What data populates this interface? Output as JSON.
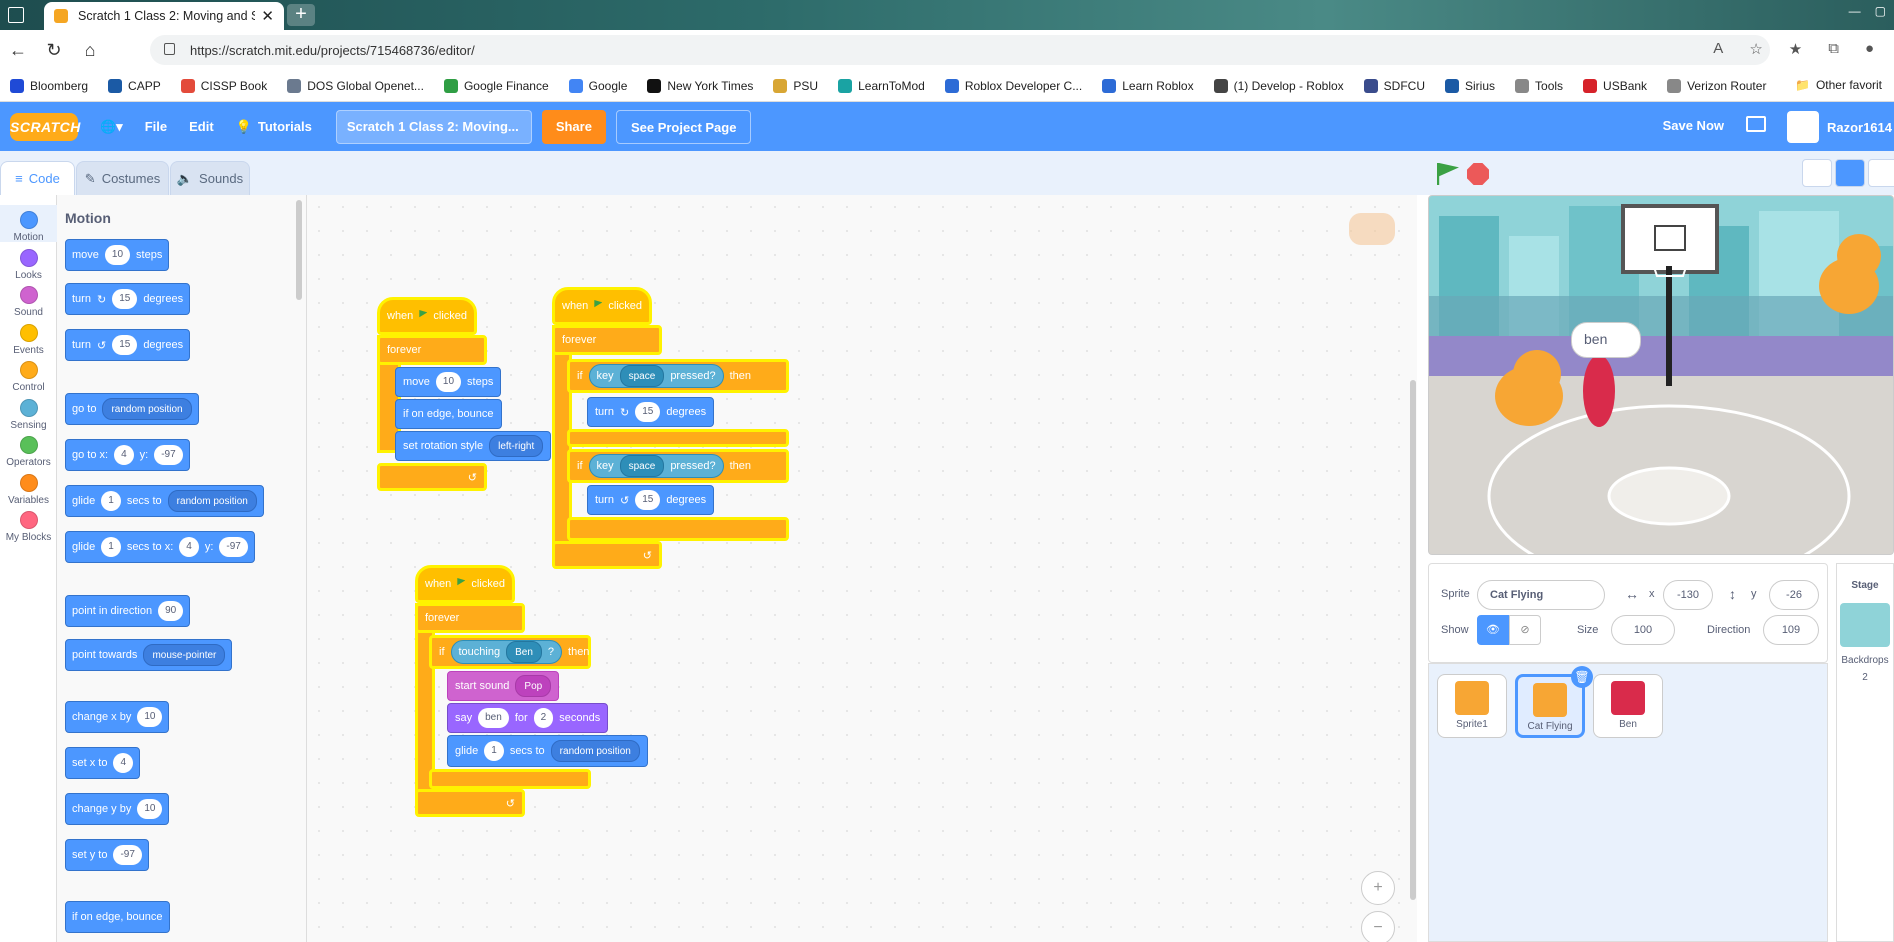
{
  "browser": {
    "tab_title": "Scratch 1 Class 2: Moving and Sc",
    "url": "https://scratch.mit.edu/projects/715468736/editor/",
    "bookmarks": [
      {
        "label": "Bloomberg",
        "color": "#1f4ad6"
      },
      {
        "label": "CAPP",
        "color": "#1b5aa5"
      },
      {
        "label": "CISSP Book",
        "color": "#e34b3b"
      },
      {
        "label": "DOS Global Openet...",
        "color": "#6b7a8f"
      },
      {
        "label": "Google Finance",
        "color": "#2f9e44"
      },
      {
        "label": "Google",
        "color": "#4285f4"
      },
      {
        "label": "New York Times",
        "color": "#111111"
      },
      {
        "label": "PSU",
        "color": "#d8a634"
      },
      {
        "label": "LearnToMod",
        "color": "#1aa3a3"
      },
      {
        "label": "Roblox Developer C...",
        "color": "#2d6bd6"
      },
      {
        "label": "Learn Roblox",
        "color": "#2d6bd6"
      },
      {
        "label": "(1) Develop - Roblox",
        "color": "#444444"
      },
      {
        "label": "SDFCU",
        "color": "#3a4c8c"
      },
      {
        "label": "Sirius",
        "color": "#1b5aa5"
      },
      {
        "label": "Tools",
        "color": "#888888"
      },
      {
        "label": "USBank",
        "color": "#d6222a"
      },
      {
        "label": "Verizon Router",
        "color": "#888888"
      }
    ],
    "other_favorites": "Other favorit"
  },
  "menu": {
    "logo": "SCRATCH",
    "file": "File",
    "edit": "Edit",
    "tutorials": "Tutorials",
    "project_title": "Scratch 1 Class 2: Moving...",
    "share": "Share",
    "see_project_page": "See Project Page",
    "save_now": "Save Now",
    "username": "Razor1614"
  },
  "tabs": {
    "code": "Code",
    "costumes": "Costumes",
    "sounds": "Sounds"
  },
  "categories": [
    {
      "label": "Motion",
      "color": "#4c97ff"
    },
    {
      "label": "Looks",
      "color": "#9966ff"
    },
    {
      "label": "Sound",
      "color": "#cf63cf"
    },
    {
      "label": "Events",
      "color": "#ffbf00"
    },
    {
      "label": "Control",
      "color": "#ffab19"
    },
    {
      "label": "Sensing",
      "color": "#5cb1d6"
    },
    {
      "label": "Operators",
      "color": "#59c059"
    },
    {
      "label": "Variables",
      "color": "#ff8c1a"
    },
    {
      "label": "My Blocks",
      "color": "#ff6680"
    }
  ],
  "palette": {
    "heading": "Motion",
    "move": {
      "a": "move",
      "v": "10",
      "b": "steps"
    },
    "turn_cw": {
      "a": "turn",
      "v": "15",
      "b": "degrees"
    },
    "turn_ccw": {
      "a": "turn",
      "v": "15",
      "b": "degrees"
    },
    "goto": {
      "a": "go to",
      "d": "random position"
    },
    "gotoxy": {
      "a": "go to x:",
      "x": "4",
      "y_label": "y:",
      "y": "-97"
    },
    "glide_to": {
      "a": "glide",
      "v": "1",
      "b": "secs to",
      "d": "random position"
    },
    "glide_xy": {
      "a": "glide",
      "v": "1",
      "b": "secs to x:",
      "x": "4",
      "y_label": "y:",
      "y": "-97"
    },
    "point_dir": {
      "a": "point in direction",
      "v": "90"
    },
    "point_towards": {
      "a": "point towards",
      "d": "mouse-pointer"
    },
    "change_x": {
      "a": "change x by",
      "v": "10"
    },
    "set_x": {
      "a": "set x to",
      "v": "4"
    },
    "change_y": {
      "a": "change y by",
      "v": "10"
    },
    "set_y": {
      "a": "set y to",
      "v": "-97"
    },
    "bounce": {
      "a": "if on edge, bounce"
    }
  },
  "scripts": {
    "s1": {
      "when": "when",
      "clicked": "clicked",
      "forever": "forever",
      "move": "move",
      "move_v": "10",
      "steps": "steps",
      "bounce": "if on edge, bounce",
      "rot": "set rotation style",
      "rot_v": "left-right"
    },
    "s2": {
      "when": "when",
      "clicked": "clicked",
      "forever": "forever",
      "if1": "if",
      "key": "key",
      "space": "space",
      "pressed": "pressed?",
      "then": "then",
      "turn1": "turn",
      "turn1_v": "15",
      "deg": "degrees",
      "if2": "if",
      "turn2": "turn",
      "turn2_v": "15"
    },
    "s3": {
      "when": "when",
      "clicked": "clicked",
      "forever": "forever",
      "if": "if",
      "touching": "touching",
      "ben": "Ben",
      "q": "?",
      "then": "then",
      "start_sound": "start sound",
      "pop": "Pop",
      "say": "say",
      "say_v": "ben",
      "for": "for",
      "secs_v": "2",
      "seconds": "seconds",
      "glide": "glide",
      "glide_v": "1",
      "secs_to": "secs to",
      "random": "random position"
    }
  },
  "stage": {
    "bubble": "ben"
  },
  "sprite_info": {
    "sprite_label": "Sprite",
    "sprite_name": "Cat Flying",
    "x_label": "x",
    "x": "-130",
    "y_label": "y",
    "y": "-26",
    "show_label": "Show",
    "size_label": "Size",
    "size": "100",
    "direction_label": "Direction",
    "direction": "109"
  },
  "sprites": [
    {
      "name": "Sprite1",
      "selected": false
    },
    {
      "name": "Cat Flying",
      "selected": true
    },
    {
      "name": "Ben",
      "selected": false
    }
  ],
  "stage_panel": {
    "label": "Stage",
    "backdrops_label": "Backdrops",
    "backdrops_count": "2"
  }
}
